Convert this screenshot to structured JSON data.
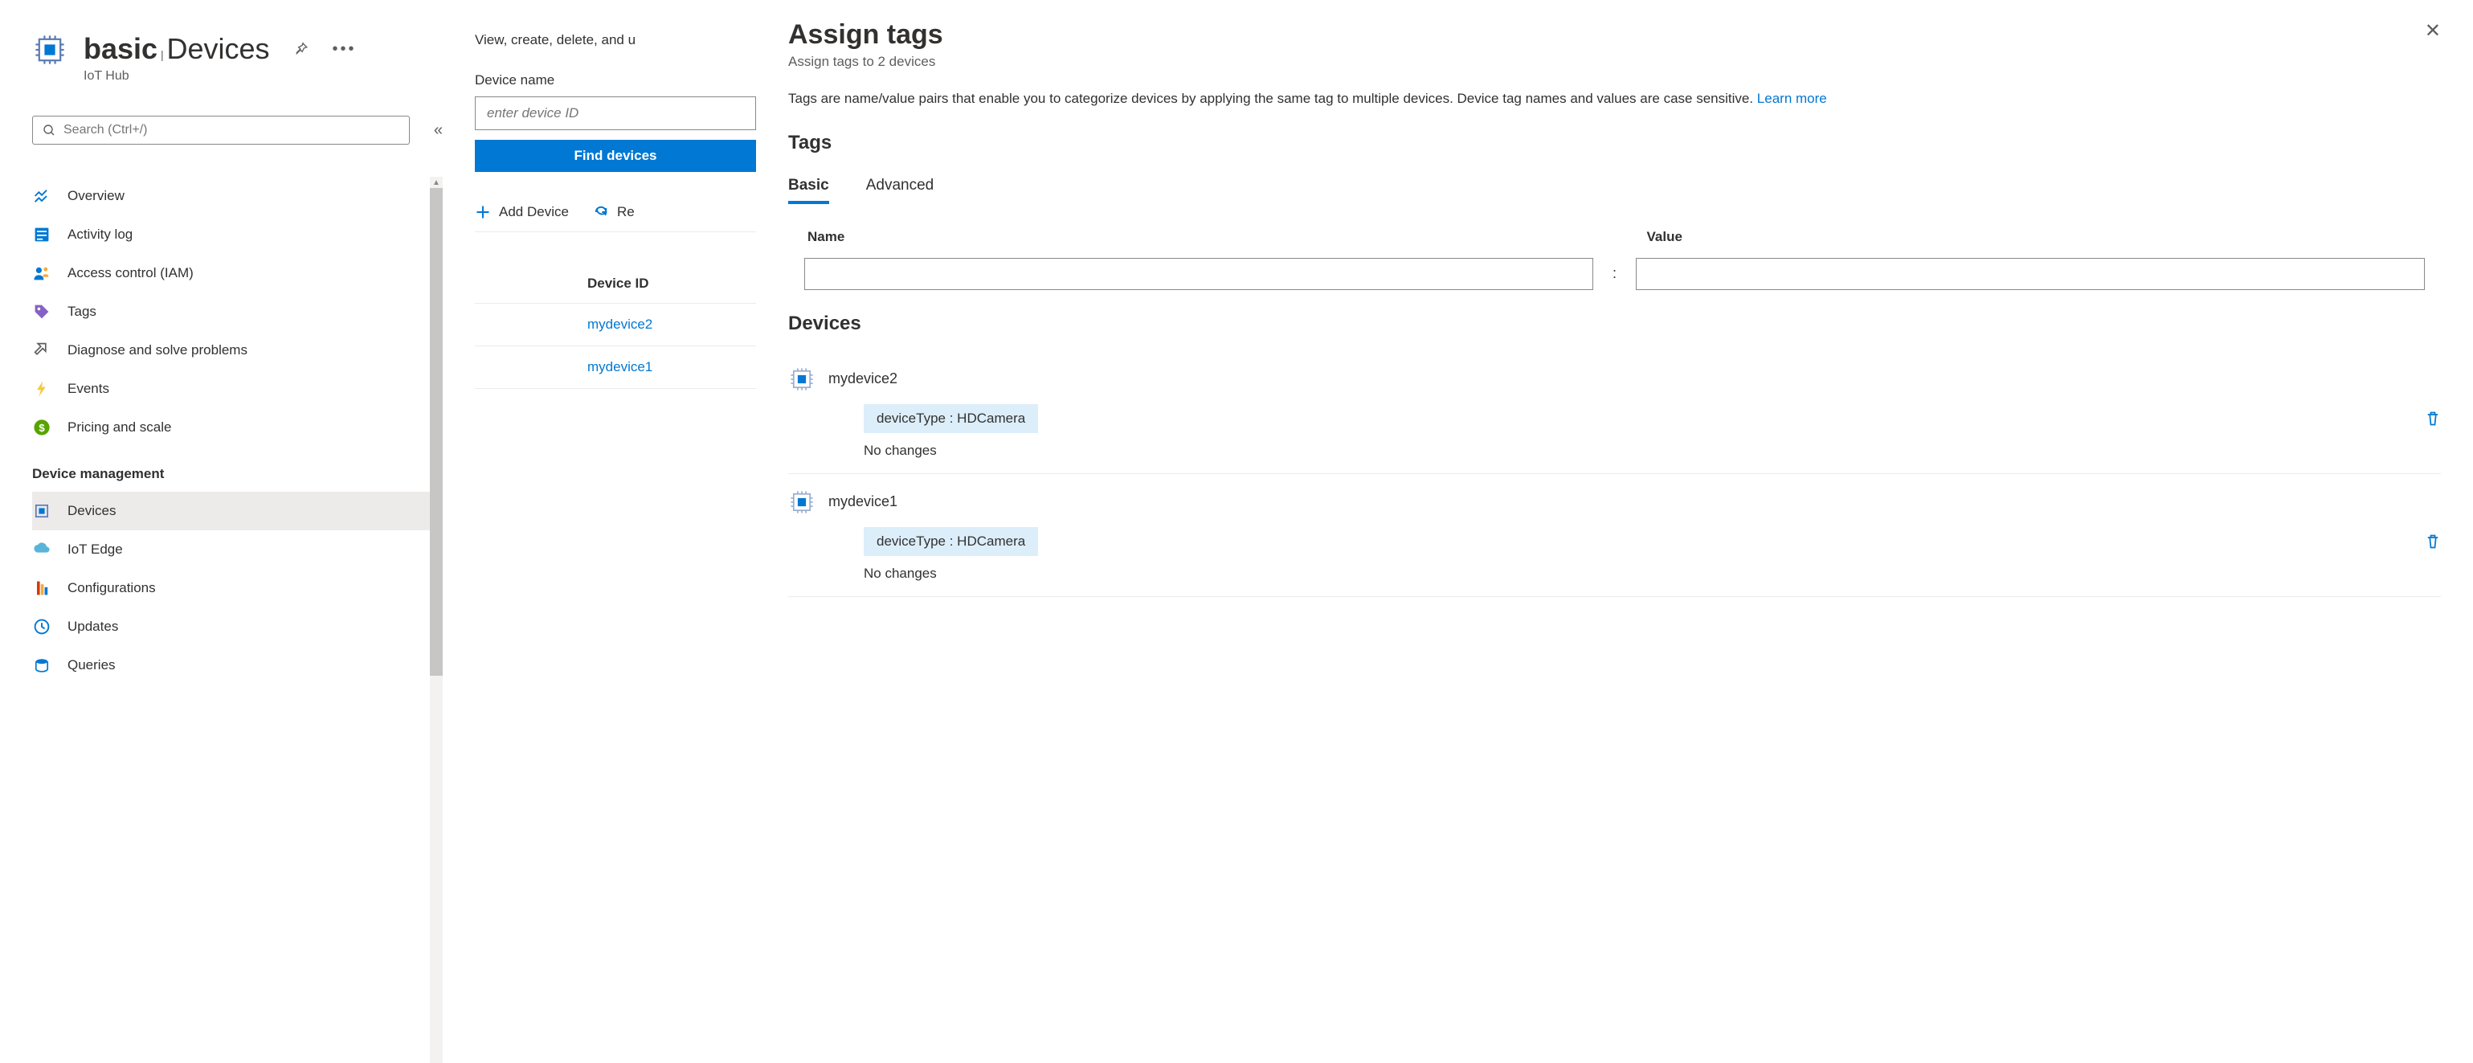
{
  "header": {
    "resource": "basic",
    "section": "Devices",
    "service": "IoT Hub"
  },
  "search": {
    "placeholder": "Search (Ctrl+/)"
  },
  "nav": {
    "items": [
      {
        "label": "Overview"
      },
      {
        "label": "Activity log"
      },
      {
        "label": "Access control (IAM)"
      },
      {
        "label": "Tags"
      },
      {
        "label": "Diagnose and solve problems"
      },
      {
        "label": "Events"
      },
      {
        "label": "Pricing and scale"
      }
    ],
    "section_label": "Device management",
    "mgmt": [
      {
        "label": "Devices"
      },
      {
        "label": "IoT Edge"
      },
      {
        "label": "Configurations"
      },
      {
        "label": "Updates"
      },
      {
        "label": "Queries"
      }
    ]
  },
  "mid": {
    "intro": "View, create, delete, and u",
    "device_name_label": "Device name",
    "device_name_placeholder": "enter device ID",
    "find_btn": "Find devices",
    "add_device": "Add Device",
    "refresh": "Re",
    "table_header": "Device ID",
    "rows": [
      "mydevice2",
      "mydevice1"
    ]
  },
  "panel": {
    "title": "Assign tags",
    "subtitle": "Assign tags to 2 devices",
    "desc_pre": "Tags are name/value pairs that enable you to categorize devices by applying the same tag to multiple devices. Device tag names and values are case sensitive. ",
    "learn_more": "Learn more",
    "tags_heading": "Tags",
    "tab_basic": "Basic",
    "tab_advanced": "Advanced",
    "col_name": "Name",
    "col_value": "Value",
    "devices_heading": "Devices",
    "devices": [
      {
        "name": "mydevice2",
        "chip": "deviceType : HDCamera",
        "status": "No changes"
      },
      {
        "name": "mydevice1",
        "chip": "deviceType : HDCamera",
        "status": "No changes"
      }
    ]
  }
}
